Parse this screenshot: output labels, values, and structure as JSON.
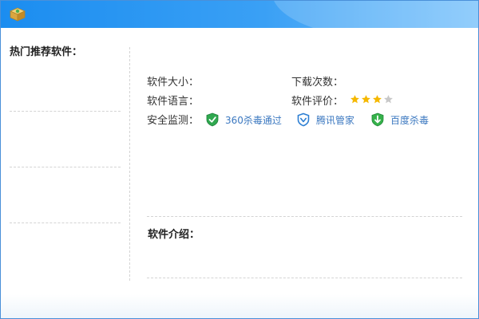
{
  "window": {
    "app_icon": "software-box-icon",
    "colors": {
      "titlebar_start": "#1b8df0",
      "titlebar_end": "#7bc3fb",
      "link": "#3b78c0",
      "star_on": "#f5b800",
      "star_off": "#c8c8c8"
    }
  },
  "sidebar": {
    "title": "热门推荐软件："
  },
  "info": {
    "size_label": "软件大小：",
    "size_value": "",
    "language_label": "软件语言：",
    "language_value": "",
    "downloads_label": "下载次数：",
    "downloads_value": "",
    "rating_label": "软件评价：",
    "rating": {
      "value": 3,
      "max": 4
    },
    "security_label": "安全监测："
  },
  "security": [
    {
      "icon": "360-shield-icon",
      "label": "360杀毒通过"
    },
    {
      "icon": "tencent-shield-icon",
      "label": "腾讯管家"
    },
    {
      "icon": "baidu-shield-icon",
      "label": "百度杀毒"
    }
  ],
  "intro": {
    "title": "软件介绍：",
    "text": ""
  }
}
